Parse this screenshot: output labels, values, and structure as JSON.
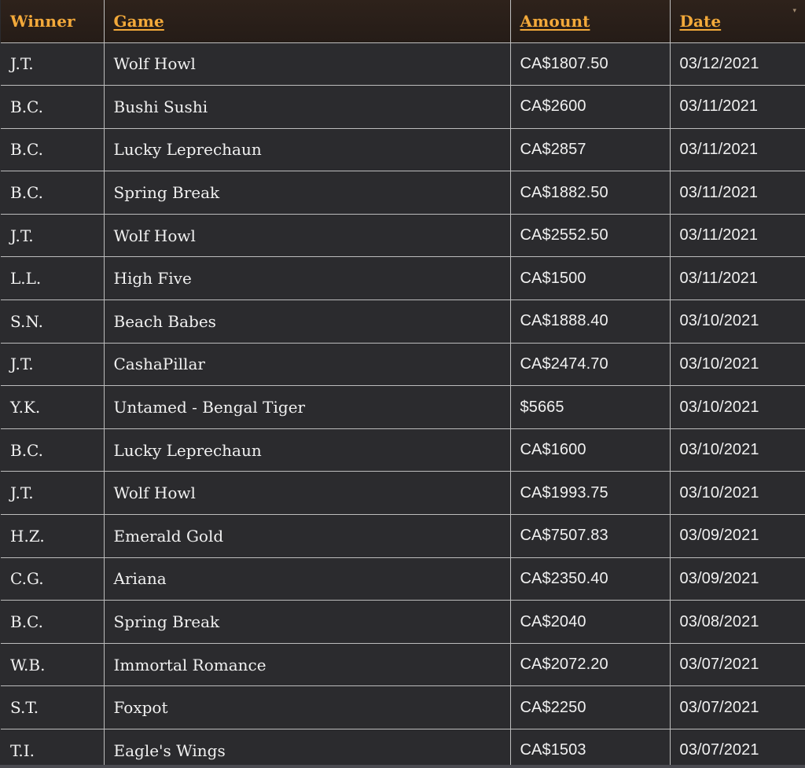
{
  "table": {
    "headers": {
      "winner": "Winner",
      "game": "Game",
      "amount": "Amount",
      "date": "Date"
    },
    "sort_indicator": "▾",
    "rows": [
      {
        "winner": "J.T.",
        "game": "Wolf Howl",
        "amount": "CA$1807.50",
        "date": "03/12/2021"
      },
      {
        "winner": "B.C.",
        "game": "Bushi Sushi",
        "amount": "CA$2600",
        "date": "03/11/2021"
      },
      {
        "winner": "B.C.",
        "game": "Lucky Leprechaun",
        "amount": "CA$2857",
        "date": "03/11/2021"
      },
      {
        "winner": "B.C.",
        "game": "Spring Break",
        "amount": "CA$1882.50",
        "date": "03/11/2021"
      },
      {
        "winner": "J.T.",
        "game": "Wolf Howl",
        "amount": "CA$2552.50",
        "date": "03/11/2021"
      },
      {
        "winner": "L.L.",
        "game": "High Five",
        "amount": "CA$1500",
        "date": "03/11/2021"
      },
      {
        "winner": "S.N.",
        "game": "Beach Babes",
        "amount": "CA$1888.40",
        "date": "03/10/2021"
      },
      {
        "winner": "J.T.",
        "game": "CashaPillar",
        "amount": "CA$2474.70",
        "date": "03/10/2021"
      },
      {
        "winner": "Y.K.",
        "game": "Untamed - Bengal Tiger",
        "amount": "$5665",
        "date": "03/10/2021"
      },
      {
        "winner": "B.C.",
        "game": "Lucky Leprechaun",
        "amount": "CA$1600",
        "date": "03/10/2021"
      },
      {
        "winner": "J.T.",
        "game": "Wolf Howl",
        "amount": "CA$1993.75",
        "date": "03/10/2021"
      },
      {
        "winner": "H.Z.",
        "game": "Emerald Gold",
        "amount": "CA$7507.83",
        "date": "03/09/2021"
      },
      {
        "winner": "C.G.",
        "game": "Ariana",
        "amount": "CA$2350.40",
        "date": "03/09/2021"
      },
      {
        "winner": "B.C.",
        "game": "Spring Break",
        "amount": "CA$2040",
        "date": "03/08/2021"
      },
      {
        "winner": "W.B.",
        "game": "Immortal Romance",
        "amount": "CA$2072.20",
        "date": "03/07/2021"
      },
      {
        "winner": "S.T.",
        "game": "Foxpot",
        "amount": "CA$2250",
        "date": "03/07/2021"
      },
      {
        "winner": "T.I.",
        "game": "Eagle's Wings",
        "amount": "CA$1503",
        "date": "03/07/2021"
      }
    ]
  },
  "colors": {
    "header_text": "#f3a93a",
    "header_bg": "#2e221b",
    "body_bg": "#2b2b2e",
    "body_text": "#f1f1f1",
    "grid_line": "#bdbdbd"
  }
}
